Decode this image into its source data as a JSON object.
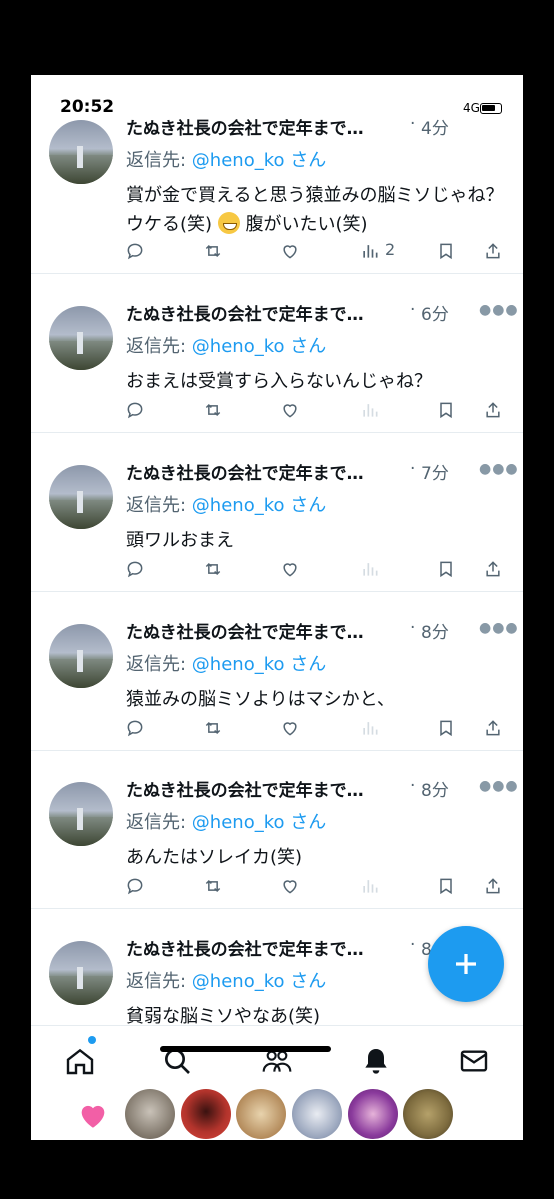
{
  "status": {
    "time": "20:52",
    "network": "4G"
  },
  "tweets": [
    {
      "name": "たぬき社長の会社で定年まで…",
      "time": "4分",
      "reply_prefix": "返信先: ",
      "reply_handle": "@heno_ko",
      "reply_suffix": "さん",
      "text_a": "賞が金で買えると思う猿並みの脳ミソじゃね？ウケる(笑)",
      "text_b": "腹がいたい(笑)",
      "emoji": "grinning-face-emoji",
      "views": "2"
    },
    {
      "name": "たぬき社長の会社で定年まで…",
      "time": "6分",
      "reply_prefix": "返信先: ",
      "reply_handle": "@heno_ko",
      "reply_suffix": "さん",
      "text": "おまえは受賞すら入らないんじゃね？"
    },
    {
      "name": "たぬき社長の会社で定年まで…",
      "time": "7分",
      "reply_prefix": "返信先: ",
      "reply_handle": "@heno_ko",
      "reply_suffix": "さん",
      "text": "頭ワルおまえ"
    },
    {
      "name": "たぬき社長の会社で定年まで…",
      "time": "8分",
      "reply_prefix": "返信先: ",
      "reply_handle": "@heno_ko",
      "reply_suffix": "さん",
      "text": "猿並みの脳ミソよりはマシかと、"
    },
    {
      "name": "たぬき社長の会社で定年まで…",
      "time": "8分",
      "reply_prefix": "返信先: ",
      "reply_handle": "@heno_ko",
      "reply_suffix": "さん",
      "text": "あんたはソレイカ(笑)"
    },
    {
      "name": "たぬき社長の会社で定年まで…",
      "time": "8分",
      "reply_prefix": "返信先: ",
      "reply_handle": "@heno_ko",
      "reply_suffix": "さん",
      "text": "貧弱な脳ミソやなあ(笑)"
    }
  ],
  "tabs": [
    "home-icon",
    "search-icon",
    "communities-icon",
    "notifications-icon",
    "messages-icon"
  ],
  "fleets": [
    "cat-avatar",
    "red-avatar",
    "kanji-avatar",
    "dog-avatar",
    "character-avatar",
    "face-avatar"
  ],
  "colors": {
    "accent": "#1d9bf0",
    "heart": "#f25fa6",
    "text": "#0f1419",
    "muted": "#536471"
  }
}
